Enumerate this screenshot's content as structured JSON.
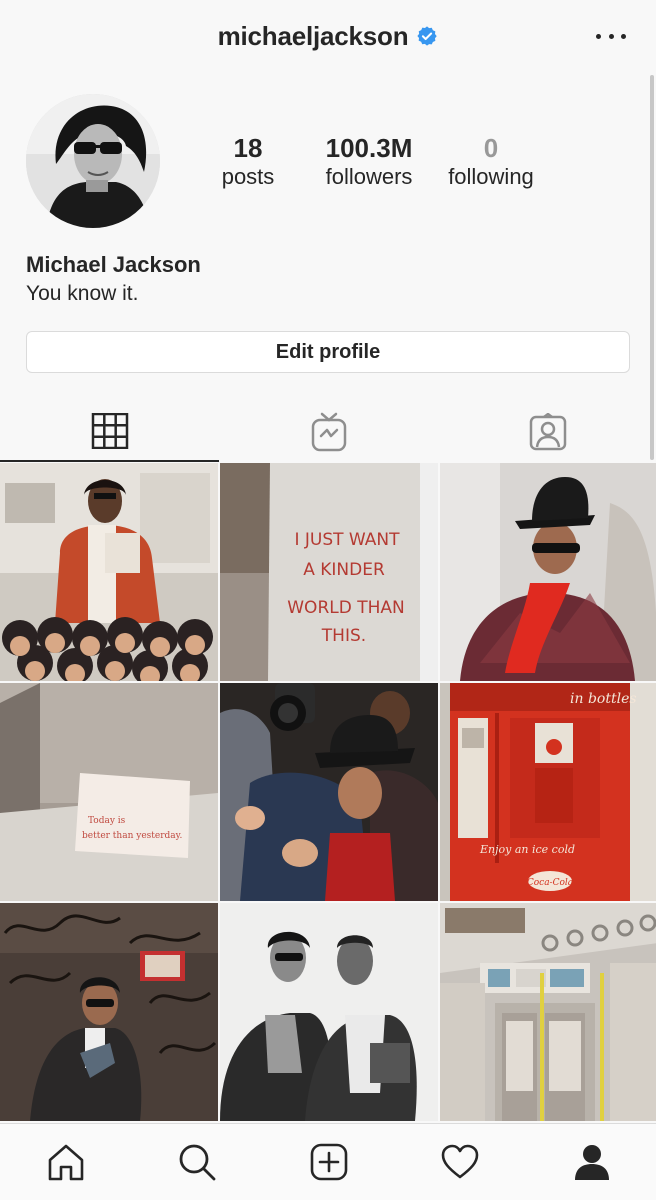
{
  "header": {
    "username": "michaeljackson",
    "verified": true
  },
  "profile": {
    "stats": [
      {
        "value": "18",
        "label": "posts"
      },
      {
        "value": "100.3M",
        "label": "followers"
      },
      {
        "value": "0",
        "label": "following"
      }
    ],
    "full_name": "Michael Jackson",
    "bio": "You know it.",
    "edit_label": "Edit profile"
  },
  "tabs": [
    {
      "icon": "grid-icon",
      "active": true
    },
    {
      "icon": "igtv-icon",
      "active": false
    },
    {
      "icon": "tagged-icon",
      "active": false
    }
  ],
  "posts": [
    {
      "caption": "Michael Jackson with group of children"
    },
    {
      "caption": "I JUST WANT A KINDER WORLD THAN THIS."
    },
    {
      "caption": "Michael Jackson in fedora and red scarf"
    },
    {
      "caption": "Today is better than yesterday."
    },
    {
      "caption": "Michael Jackson in crowd with camera"
    },
    {
      "caption": "in bottles — Enjoy an ice cold Coca-Cola"
    },
    {
      "caption": "Michael Jackson in graffiti subway car"
    },
    {
      "caption": "Michael Jackson with friend"
    },
    {
      "caption": "Subway train interior"
    }
  ],
  "post_text": {
    "wall": [
      "I JUST WANT",
      "A KINDER",
      "WORLD THAN",
      "THIS."
    ],
    "card": [
      "Today is",
      "better than yesterday."
    ],
    "machine_top": "in bottles",
    "machine_bottom": "Enjoy an ice cold",
    "machine_brand": "Coca-Cola"
  },
  "bottom_nav": [
    "home-icon",
    "search-icon",
    "new-post-icon",
    "activity-icon",
    "profile-icon"
  ],
  "colors": {
    "accent_verified": "#3897f0",
    "text": "#262626",
    "border": "#dbdbdb"
  }
}
